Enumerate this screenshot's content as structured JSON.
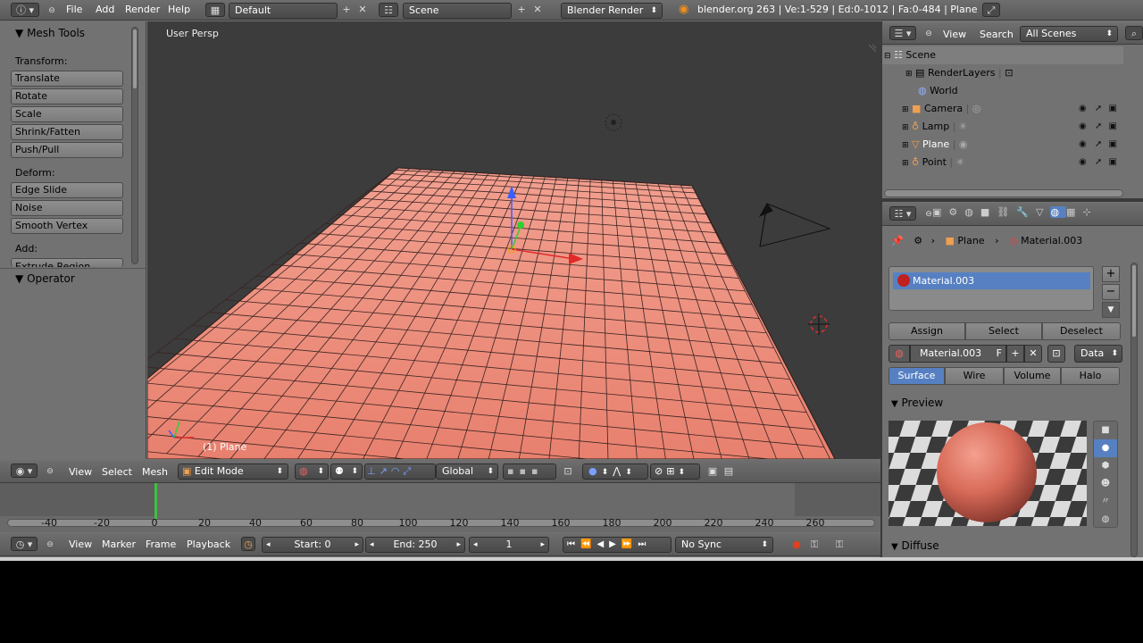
{
  "top_bar": {
    "menus": [
      "File",
      "Add",
      "Render",
      "Help"
    ],
    "layout": "Default",
    "scene": "Scene",
    "engine": "Blender Render",
    "stats": "blender.org 263 | Ve:1-529 | Ed:0-1012 | Fa:0-484 | Plane"
  },
  "tool_shelf": {
    "title": "Mesh Tools",
    "transform_label": "Transform:",
    "transform_buttons": [
      "Translate",
      "Rotate",
      "Scale",
      "Shrink/Fatten",
      "Push/Pull"
    ],
    "deform_label": "Deform:",
    "deform_buttons": [
      "Edge Slide",
      "Noise",
      "Smooth Vertex"
    ],
    "add_label": "Add:",
    "add_partial": "Extrude Region",
    "operator_title": "Operator"
  },
  "viewport": {
    "view_name": "User Persp",
    "object_label": "(1) Plane",
    "mesh_color": "#f08878"
  },
  "view_header": {
    "menus": [
      "View",
      "Select",
      "Mesh"
    ],
    "mode": "Edit Mode",
    "orientation": "Global"
  },
  "timeline": {
    "ticks": [
      "-40",
      "-20",
      "0",
      "20",
      "40",
      "60",
      "80",
      "100",
      "120",
      "140",
      "160",
      "180",
      "200",
      "220",
      "240",
      "260"
    ],
    "current_frame_marker": "0"
  },
  "timeline_header": {
    "menus": [
      "View",
      "Marker",
      "Frame",
      "Playback"
    ],
    "start": "Start: 0",
    "end": "End: 250",
    "current": "1",
    "sync": "No Sync"
  },
  "outliner": {
    "menus": [
      "View",
      "Search"
    ],
    "filter": "All Scenes",
    "items": [
      "Scene",
      "RenderLayers",
      "World",
      "Camera",
      "Lamp",
      "Plane",
      "Point"
    ]
  },
  "properties": {
    "breadcrumb_object": "Plane",
    "breadcrumb_material": "Material.003",
    "slot_name": "Material.003",
    "buttons": [
      "Assign",
      "Select",
      "Deselect"
    ],
    "material_field": "Material.003",
    "f_label": "F",
    "data_label": "Data",
    "tabs": [
      "Surface",
      "Wire",
      "Volume",
      "Halo"
    ],
    "preview_label": "Preview",
    "diffuse_label": "Diffuse"
  }
}
